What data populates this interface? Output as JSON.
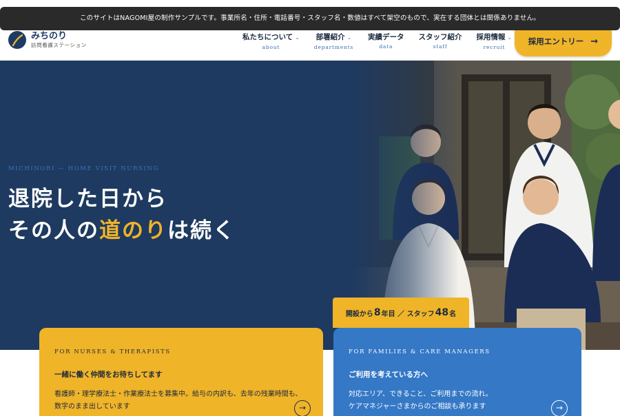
{
  "notice": "このサイトはNAGOMI屋の制作サンプルです。事業所名・住所・電話番号・スタッフ名・数値はすべて架空のもので、実在する団体とは関係ありません。",
  "brand": {
    "name": "みちのり",
    "subtitle": "訪問看護ステーション"
  },
  "nav": [
    {
      "label": "私たちについて",
      "sub": "about",
      "has_dropdown": true
    },
    {
      "label": "部署紹介",
      "sub": "departments",
      "has_dropdown": true
    },
    {
      "label": "実績データ",
      "sub": "data",
      "has_dropdown": false
    },
    {
      "label": "スタッフ紹介",
      "sub": "staff",
      "has_dropdown": false
    },
    {
      "label": "採用情報",
      "sub": "recruit",
      "has_dropdown": true
    }
  ],
  "entry_button": {
    "label": "採用エントリー",
    "arrow": "→"
  },
  "hero": {
    "eyebrow": "MICHINORI — HOME VISIT NURSING",
    "headline_line1": "退院した日から",
    "headline_line2_pre": "その人の",
    "headline_line2_accent": "道のり",
    "headline_line2_post": "は続く"
  },
  "stat": {
    "prefix": "開設から",
    "years": "8",
    "years_unit": "年目 ／ スタッフ",
    "staff": "48",
    "staff_unit": "名"
  },
  "cards": [
    {
      "label": "FOR NURSES & THERAPISTS",
      "title": "一緒に働く仲間をお待ちしてます",
      "body_line1": "看護師・理学療法士・作業療法士を募集中。給与の内訳も、去年の残業時間も、",
      "body_line2": "数字のまま出しています",
      "arrow": "→"
    },
    {
      "label": "FOR FAMILIES & CARE MANAGERS",
      "title": "ご利用を考えている方へ",
      "body_line1": "対応エリア、できること、ご利用までの流れ。",
      "body_line2": "ケアマネジャーさまからのご相談も承ります",
      "arrow": "→"
    }
  ],
  "colors": {
    "navy": "#1e3a60",
    "accent_yellow": "#f0b429",
    "card_blue": "#3478c6"
  }
}
